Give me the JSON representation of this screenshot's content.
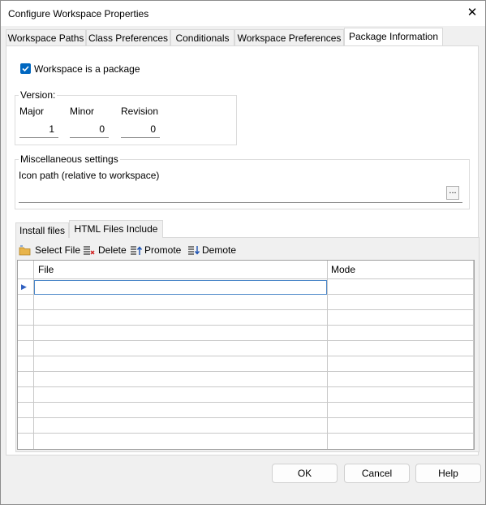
{
  "window": {
    "title": "Configure Workspace Properties",
    "close_glyph": "✕"
  },
  "tabs": [
    {
      "label": "Workspace Paths"
    },
    {
      "label": "Class Preferences"
    },
    {
      "label": "Conditionals"
    },
    {
      "label": "Workspace Preferences"
    },
    {
      "label": "Package Information",
      "active": true
    }
  ],
  "package": {
    "checkbox_label": "Workspace is a package",
    "checked": true,
    "version": {
      "legend": "Version:",
      "major_label": "Major",
      "major_value": "1",
      "minor_label": "Minor",
      "minor_value": "0",
      "revision_label": "Revision",
      "revision_value": "0"
    },
    "misc": {
      "legend": "Miscellaneous settings",
      "icon_path_label": "Icon path (relative to workspace)",
      "icon_path_value": "",
      "browse_glyph": "..."
    }
  },
  "subtabs": [
    {
      "label": "Install files"
    },
    {
      "label": "HTML Files Include",
      "active": true
    }
  ],
  "toolbar": {
    "select_file": "Select File",
    "delete": "Delete",
    "promote": "Promote",
    "demote": "Demote"
  },
  "grid": {
    "columns": [
      "File",
      "Mode"
    ],
    "row_count": 10,
    "current_row_marker": "▶"
  },
  "buttons": {
    "ok": "OK",
    "cancel": "Cancel",
    "help": "Help"
  },
  "colors": {
    "accent": "#0067c0",
    "background": "#f0f0f0",
    "grid_line": "#c8c8c8"
  }
}
